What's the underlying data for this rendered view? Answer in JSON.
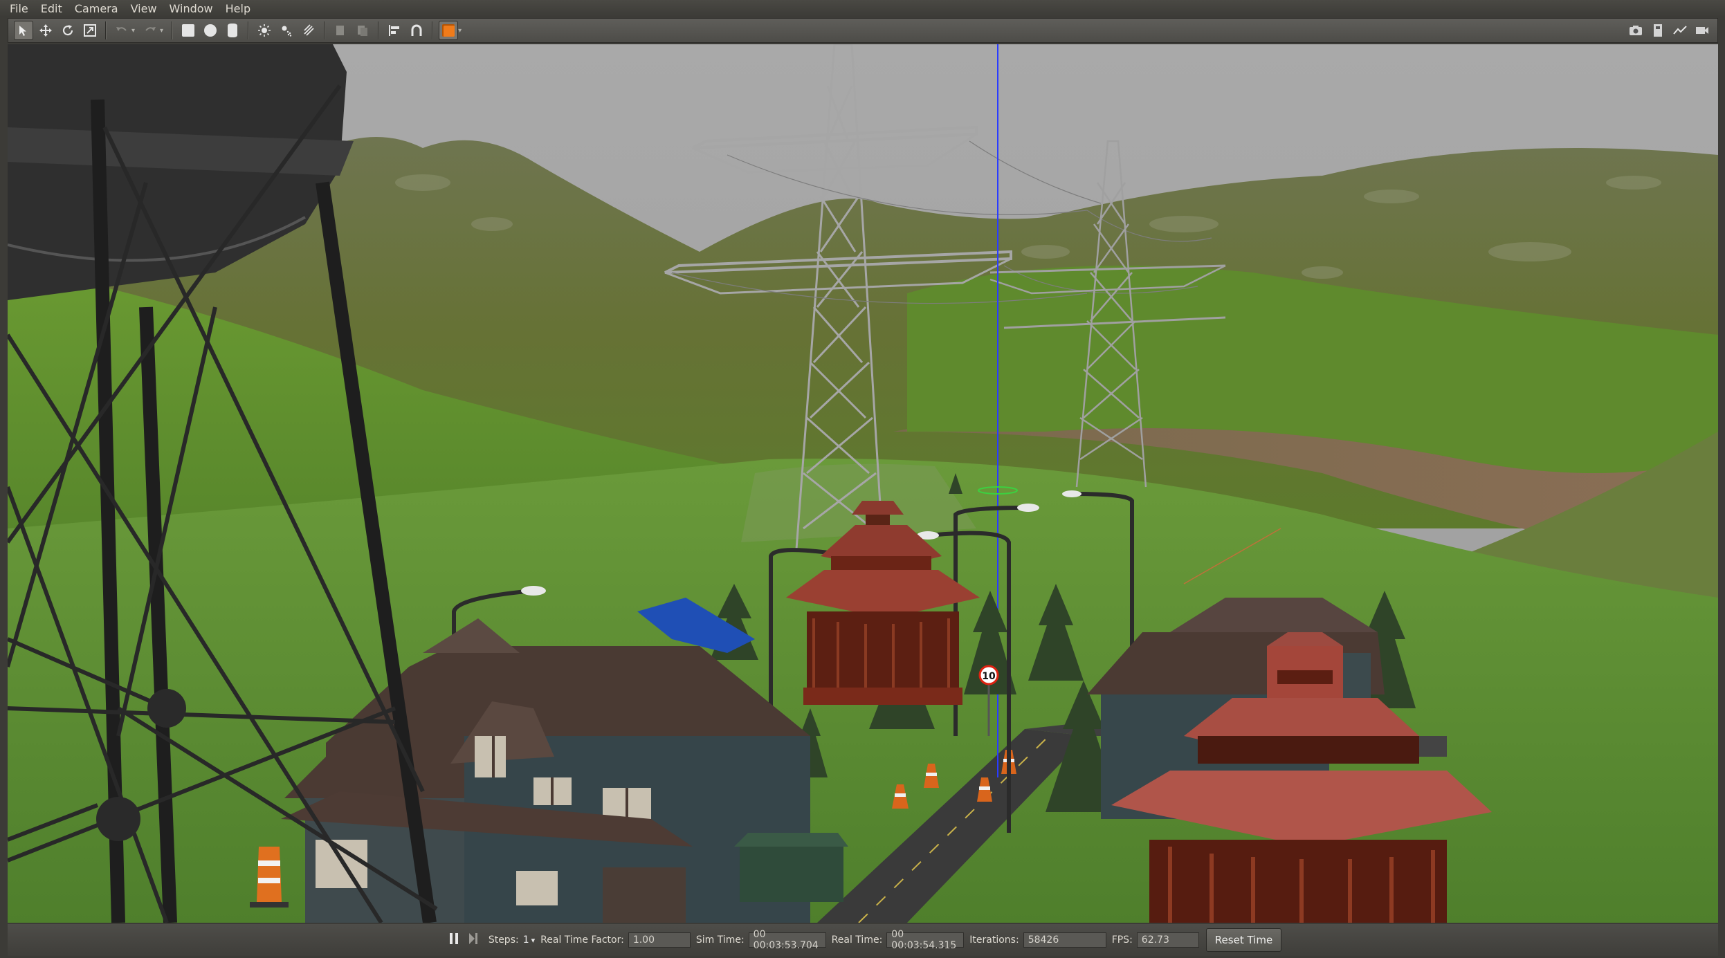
{
  "menu": [
    "File",
    "Edit",
    "Camera",
    "View",
    "Window",
    "Help"
  ],
  "toolbar": {
    "tools": [
      "select-arrow-icon",
      "translate-icon",
      "rotate-icon",
      "scale-icon"
    ],
    "history": [
      "undo-icon",
      "redo-icon"
    ],
    "shapes": [
      "box-icon",
      "sphere-icon",
      "cylinder-icon"
    ],
    "lights": [
      "point-light-icon",
      "spot-light-icon",
      "directional-light-icon"
    ],
    "right": [
      "screenshot-icon",
      "record-icon",
      "plot-icon",
      "video-icon"
    ]
  },
  "status": {
    "steps_label": "Steps:",
    "steps_value": "1",
    "rtf_label": "Real Time Factor:",
    "rtf_value": "1.00",
    "sim_label": "Sim Time:",
    "sim_value": "00 00:03:53.704",
    "real_label": "Real Time:",
    "real_value": "00 00:03:54.315",
    "iter_label": "Iterations:",
    "iter_value": "58426",
    "fps_label": "FPS:",
    "fps_value": "62.73",
    "reset_label": "Reset Time"
  },
  "scene": {
    "speed_sign": "10",
    "colors": {
      "sky": "#a5a5a5",
      "mountain": "#5f6a3a",
      "grass": "#5e8c2e",
      "road": "#3d3d3d",
      "roof_dark": "#4b3a33",
      "gazebo": "#8a2e22",
      "tower": "#9a9a9a",
      "water_tower": "#2e2e2e"
    }
  }
}
